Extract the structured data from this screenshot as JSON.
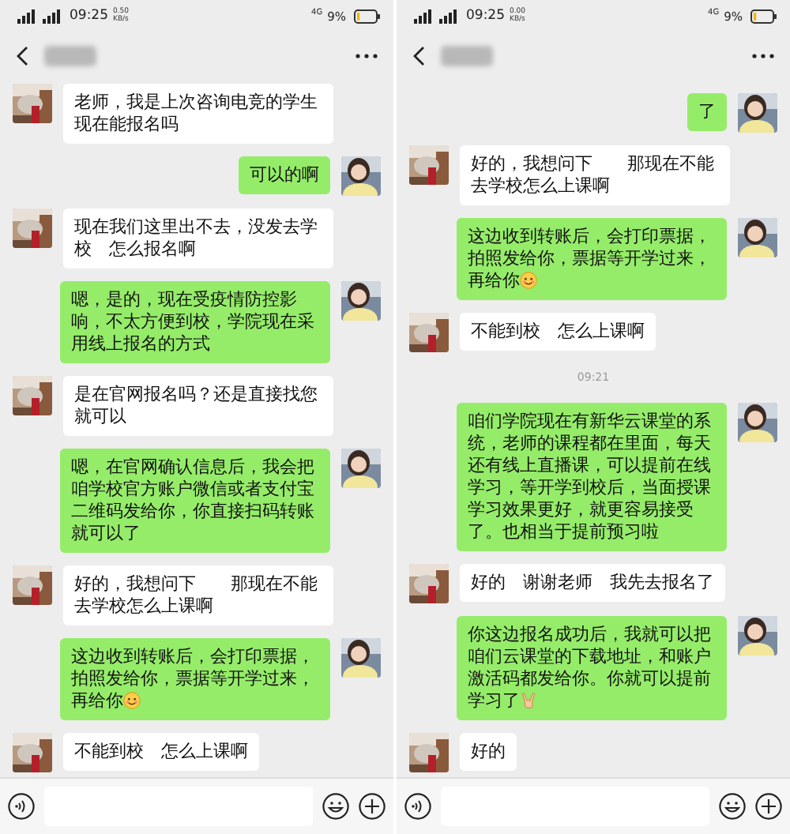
{
  "panels": [
    {
      "status_bar": {
        "time": "09:25",
        "net_speed": [
          "0.50",
          "KB/s"
        ],
        "network": "4G",
        "battery": "9%"
      },
      "messages": [
        {
          "kind": "received",
          "text": "老师，我是上次咨询电竞的学生现在能报名吗"
        },
        {
          "kind": "sent",
          "text": "可以的啊"
        },
        {
          "kind": "received",
          "text": "现在我们这里出不去，没发去学校　怎么报名啊"
        },
        {
          "kind": "sent",
          "text": "嗯，是的，现在受疫情防控影响，不太方便到校，学院现在采用线上报名的方式"
        },
        {
          "kind": "received",
          "text": "是在官网报名吗？还是直接找您就可以"
        },
        {
          "kind": "sent",
          "text": "嗯，在官网确认信息后，我会把咱学校官方账户微信或者支付宝二维码发给你，你直接扫码转账就可以了"
        },
        {
          "kind": "received",
          "text": "好的，我想问下　　那现在不能去学校怎么上课啊"
        },
        {
          "kind": "sent",
          "text": "这边收到转账后，会打印票据，拍照发给你，票据等开学过来，再给你",
          "emoji": {
            "kind": "smile"
          }
        },
        {
          "kind": "received",
          "text": "不能到校　怎么上课啊"
        }
      ]
    },
    {
      "status_bar": {
        "time": "09:25",
        "net_speed": [
          "0.00",
          "KB/s"
        ],
        "network": "4G",
        "battery": "9%"
      },
      "messages": [
        {
          "kind": "sent",
          "text": "了"
        },
        {
          "kind": "received",
          "text": "好的，我想问下　　那现在不能去学校怎么上课啊"
        },
        {
          "kind": "sent",
          "text": "这边收到转账后，会打印票据，拍照发给你，票据等开学过来，再给你",
          "emoji": {
            "kind": "smile"
          }
        },
        {
          "kind": "received",
          "text": "不能到校　怎么上课啊"
        },
        {
          "kind": "time",
          "text": "09:21"
        },
        {
          "kind": "sent",
          "text": "咱们学院现在有新华云课堂的系统，老师的课程都在里面，每天还有线上直播课，可以提前在线学习，等开学到校后，当面授课学习效果更好，就更容易接受了。也相当于提前预习啦"
        },
        {
          "kind": "received",
          "text": "好的　谢谢老师　我先去报名了"
        },
        {
          "kind": "sent",
          "text": "你这边报名成功后，我就可以把咱们云课堂的下载地址，和账户激活码都发给你。你就可以提前学习了",
          "emoji": {
            "kind": "victory"
          }
        },
        {
          "kind": "received",
          "text": "好的"
        }
      ]
    }
  ]
}
